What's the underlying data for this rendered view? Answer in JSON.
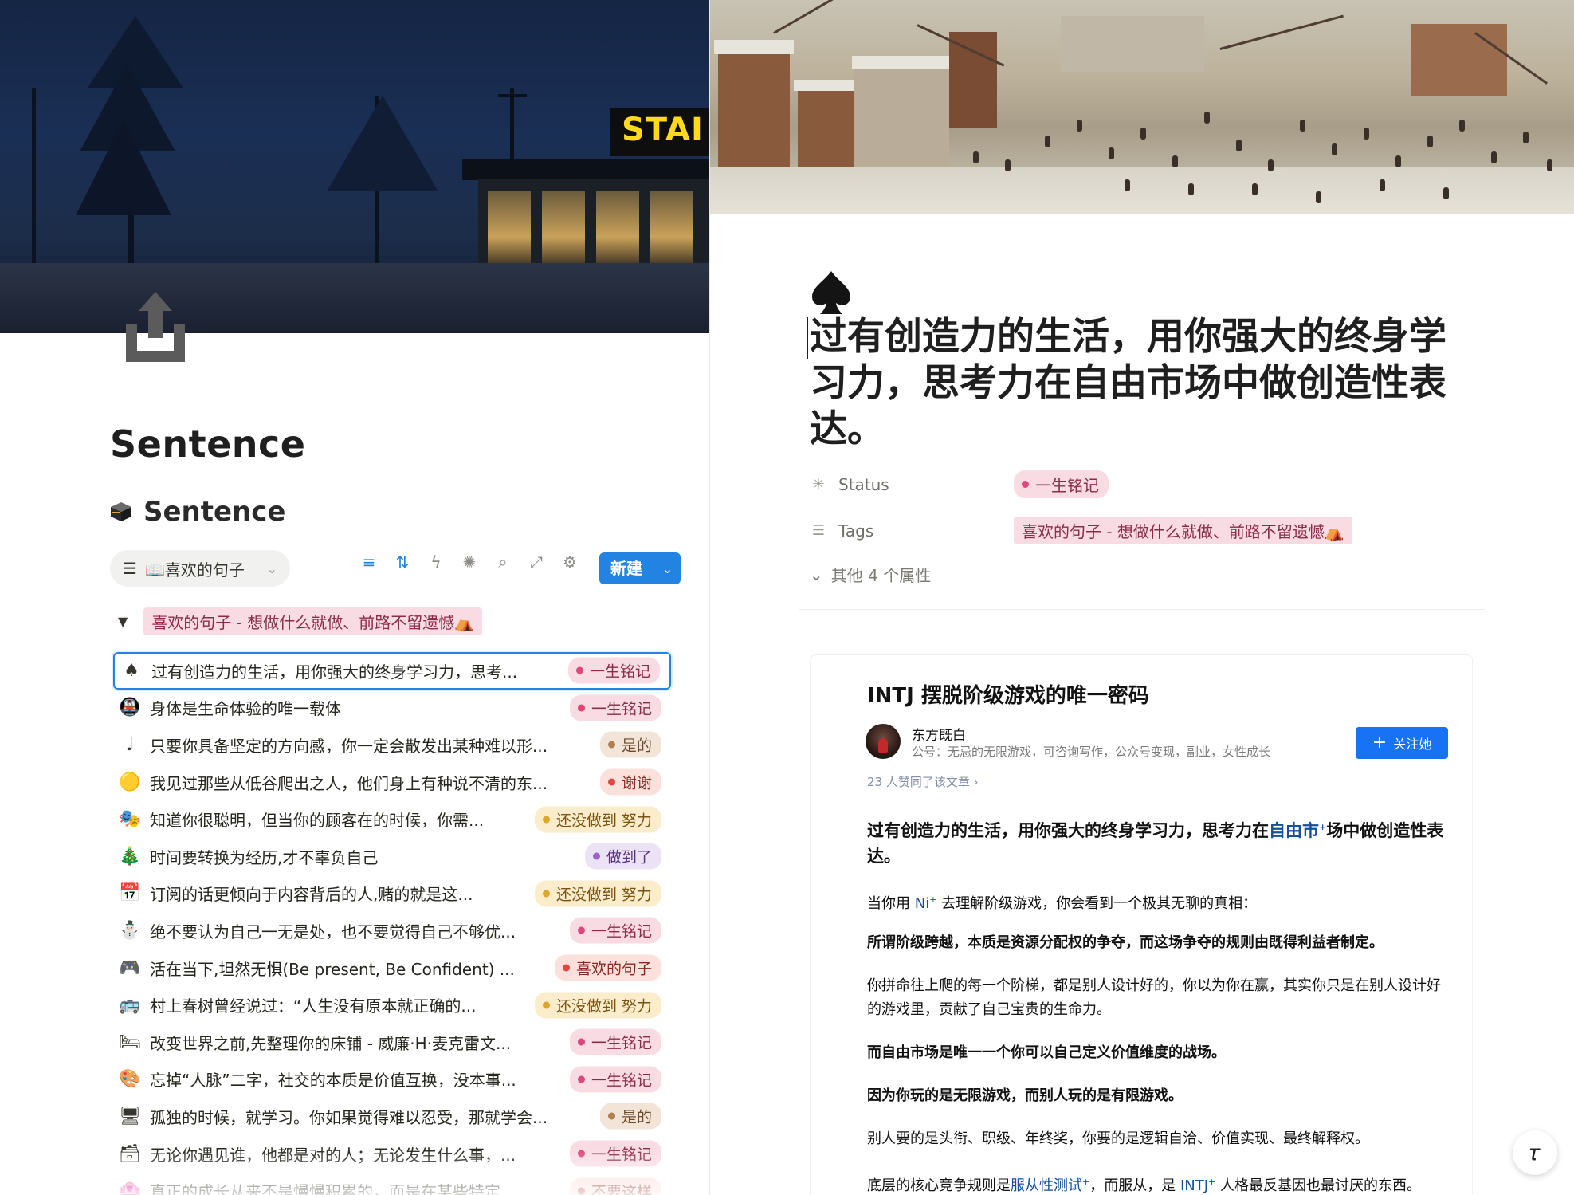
{
  "left": {
    "cover": {
      "sign_text": "STAI"
    },
    "page_title": "Sentence",
    "database_title": "Sentence",
    "view_tab": {
      "label": "📖喜欢的句子"
    },
    "new_button": {
      "label": "新建"
    },
    "group": {
      "label": "喜欢的句子 - 想做什么就做、前路不留遗憾⛺"
    },
    "rows": [
      {
        "emoji": "♠",
        "text": "过有创造力的生活，用你强大的终身学习力，思考...",
        "badge": "一生铭记",
        "badge_color": "#f9dbe4",
        "dot": "#e0457b",
        "fg": "#8a2d48",
        "selected": true
      },
      {
        "emoji": "🚇",
        "text": "身体是生命体验的唯一载体",
        "badge": "一生铭记",
        "badge_color": "#f9dbe4",
        "dot": "#e0457b",
        "fg": "#8a2d48"
      },
      {
        "emoji": "♩",
        "text": "只要你具备坚定的方向感，你一定会散发出某种难以形...",
        "badge": "是的",
        "badge_color": "#f2e4d6",
        "dot": "#b07f52",
        "fg": "#6e4a2a"
      },
      {
        "emoji": "🟡",
        "text": "我见过那些从低谷爬出之人，他们身上有种说不清的东...",
        "badge": "谢谢",
        "badge_color": "#fbe0dc",
        "dot": "#e0483f",
        "fg": "#8a2a24"
      },
      {
        "emoji": "🎭",
        "text": "知道你很聪明，但当你的顾客在的时候，你需...",
        "badge": "还没做到 努力",
        "badge_color": "#fbeccb",
        "dot": "#e0a62b",
        "fg": "#7a5413"
      },
      {
        "emoji": "🎄",
        "text": "时间要转换为经历,才不辜负自己",
        "badge": "做到了",
        "badge_color": "#ece2f5",
        "dot": "#9a63c7",
        "fg": "#5a3480"
      },
      {
        "emoji": "📅",
        "text": "订阅的话更倾向于内容背后的人,赌的就是这...",
        "badge": "还没做到 努力",
        "badge_color": "#fbeccb",
        "dot": "#e0a62b",
        "fg": "#7a5413"
      },
      {
        "emoji": "⛄",
        "text": "绝不要认为自己一无是处，也不要觉得自己不够优...",
        "badge": "一生铭记",
        "badge_color": "#f9dbe4",
        "dot": "#e0457b",
        "fg": "#8a2d48"
      },
      {
        "emoji": "🎮",
        "text": "活在当下,坦然无惧(Be present, Be Confident) ...",
        "badge": "喜欢的句子",
        "badge_color": "#fbe0dc",
        "dot": "#e0483f",
        "fg": "#8a2a24"
      },
      {
        "emoji": "🚌",
        "text": "村上春树曾经说过：“人生没有原本就正确的...",
        "badge": "还没做到 努力",
        "badge_color": "#fbeccb",
        "dot": "#e0a62b",
        "fg": "#7a5413"
      },
      {
        "emoji": "🛏",
        "text": "改变世界之前,先整理你的床铺 - 威廉·H·麦克雷文...",
        "badge": "一生铭记",
        "badge_color": "#f9dbe4",
        "dot": "#e0457b",
        "fg": "#8a2d48"
      },
      {
        "emoji": "🎨",
        "text": "忘掉“人脉”二字，社交的本质是价值互换，没本事...",
        "badge": "一生铭记",
        "badge_color": "#f9dbe4",
        "dot": "#e0457b",
        "fg": "#8a2d48"
      },
      {
        "emoji": "🖥",
        "text": "孤独的时候，就学习。你如果觉得难以忍受，那就学会...",
        "badge": "是的",
        "badge_color": "#f2e4d6",
        "dot": "#b07f52",
        "fg": "#6e4a2a"
      },
      {
        "emoji": "🗃",
        "text": "无论你遇见谁，他都是对的人；无论发生什么事，...",
        "badge": "一生铭记",
        "badge_color": "#f9dbe4",
        "dot": "#e0457b",
        "fg": "#8a2d48"
      },
      {
        "emoji": "🏩",
        "text": "真正的成长从来不是慢慢积累的，而是在某些特定...",
        "badge": "不要这样",
        "badge_color": "#fbe0dc",
        "dot": "#e0483f",
        "fg": "#8a2a24"
      }
    ]
  },
  "right": {
    "doc_title": "过有创造力的生活，用你强大的终身学习力，思考力在自由市场中做创造性表达。",
    "properties": {
      "status": {
        "label": "Status",
        "value": "一生铭记"
      },
      "tags": {
        "label": "Tags",
        "value": "喜欢的句子 - 想做什么就做、前路不留遗憾⛺"
      },
      "more": "其他 4 个属性"
    },
    "article": {
      "title": "INTJ 摆脱阶级游戏的唯一密码",
      "author": "东方既白",
      "bio": "公号：无忌的无限游戏，可咨询写作，公众号变现，副业，女性成长",
      "follow": "关注她",
      "likes": "23 人赞同了该文章 ›",
      "lead_a": "过有创造力的生活，用你强大的终身学习力，思考力在",
      "lead_link": "自由市",
      "lead_b": "场中做创造性表达。",
      "p1_a": "当你用 ",
      "p1_link": "Ni",
      "p1_b": " 去理解阶级游戏，你会看到一个极其无聊的真相：",
      "p2": "所谓阶级跨越，本质是资源分配权的争夺，而这场争夺的规则由既得利益者制定。",
      "p3": "你拼命往上爬的每一个阶梯，都是别人设计好的，你以为你在赢，其实你只是在别人设计好的游戏里，贡献了自己宝贵的生命力。",
      "p4": "而自由市场是唯一一个你可以自己定义价值维度的战场。",
      "p5": "因为你玩的是无限游戏，而别人玩的是有限游戏。",
      "p6": "别人要的是头衔、职级、年终奖，你要的是逻辑自洽、价值实现、最终解释权。",
      "p7_a": "底层的核心竞争规则是",
      "p7_link1": "服从性测试",
      "p7_b": "，而服从，是 ",
      "p7_link2": "INTJ",
      "p7_c": " 人格最反基因也最讨厌的东西。"
    }
  }
}
